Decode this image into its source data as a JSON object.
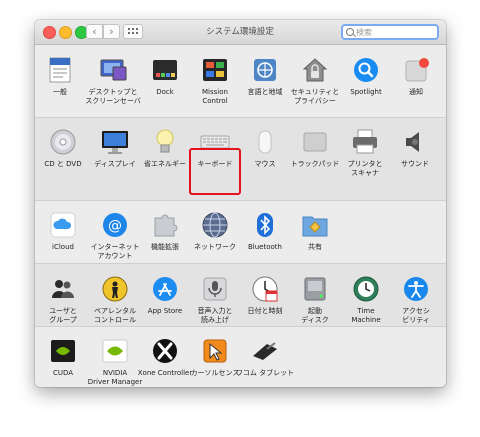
{
  "window": {
    "title": "システム環境設定"
  },
  "toolbar": {
    "back": "‹",
    "forward": "›"
  },
  "search": {
    "placeholder": "検索"
  },
  "sections": [
    {
      "items": [
        {
          "label": "一般",
          "icon": "general-file-icon"
        },
        {
          "label": "デスクトップと\nスクリーンセーバ",
          "icon": "desktop-icon"
        },
        {
          "label": "Dock",
          "icon": "dock-icon"
        },
        {
          "label": "Mission\nControl",
          "icon": "mission-control-icon"
        },
        {
          "label": "言語と地域",
          "icon": "globe-flag-icon"
        },
        {
          "label": "セキュリティと\nプライバシー",
          "icon": "house-lock-icon"
        },
        {
          "label": "Spotlight",
          "icon": "spotlight-icon"
        },
        {
          "label": "通知",
          "icon": "notifications-icon"
        }
      ]
    },
    {
      "items": [
        {
          "label": "CD と DVD",
          "icon": "cd-icon"
        },
        {
          "label": "ディスプレイ",
          "icon": "display-icon"
        },
        {
          "label": "省エネルギー",
          "icon": "bulb-icon"
        },
        {
          "label": "キーボード",
          "icon": "keyboard-icon"
        },
        {
          "label": "マウス",
          "icon": "mouse-icon"
        },
        {
          "label": "トラックパッド",
          "icon": "trackpad-icon"
        },
        {
          "label": "プリンタと\nスキャナ",
          "icon": "printer-icon"
        },
        {
          "label": "サウンド",
          "icon": "speaker-icon"
        }
      ]
    },
    {
      "items": [
        {
          "label": "iCloud",
          "icon": "icloud-icon"
        },
        {
          "label": "インターネット\nアカウント",
          "icon": "internet-accounts-icon"
        },
        {
          "label": "機能拡張",
          "icon": "extensions-icon"
        },
        {
          "label": "ネットワーク",
          "icon": "network-icon"
        },
        {
          "label": "Bluetooth",
          "icon": "bluetooth-icon"
        },
        {
          "label": "共有",
          "icon": "sharing-icon"
        }
      ]
    },
    {
      "items": [
        {
          "label": "ユーザと\nグループ",
          "icon": "users-icon"
        },
        {
          "label": "ペアレンタル\nコントロール",
          "icon": "parental-icon"
        },
        {
          "label": "App Store",
          "icon": "app-store-icon"
        },
        {
          "label": "音声入力と\n読み上げ",
          "icon": "microphone-icon"
        },
        {
          "label": "日付と時刻",
          "icon": "calendar-clock-icon"
        },
        {
          "label": "起動\nディスク",
          "icon": "startup-disk-icon"
        },
        {
          "label": "Time\nMachine",
          "icon": "time-machine-icon"
        },
        {
          "label": "アクセシ\nビリティ",
          "icon": "accessibility-icon"
        }
      ]
    },
    {
      "items": [
        {
          "label": "CUDA",
          "icon": "cuda-icon"
        },
        {
          "label": "NVIDIA\nDriver Manager",
          "icon": "nvidia-icon"
        },
        {
          "label": "Xone Controller",
          "icon": "xbox-icon"
        },
        {
          "label": "カーソルセンス",
          "icon": "cursorsense-icon"
        },
        {
          "label": "ワコム タブレット",
          "icon": "wacom-icon"
        }
      ]
    }
  ],
  "colors": {
    "accent": "#e4121d",
    "search_focus": "#7aaaf2"
  }
}
